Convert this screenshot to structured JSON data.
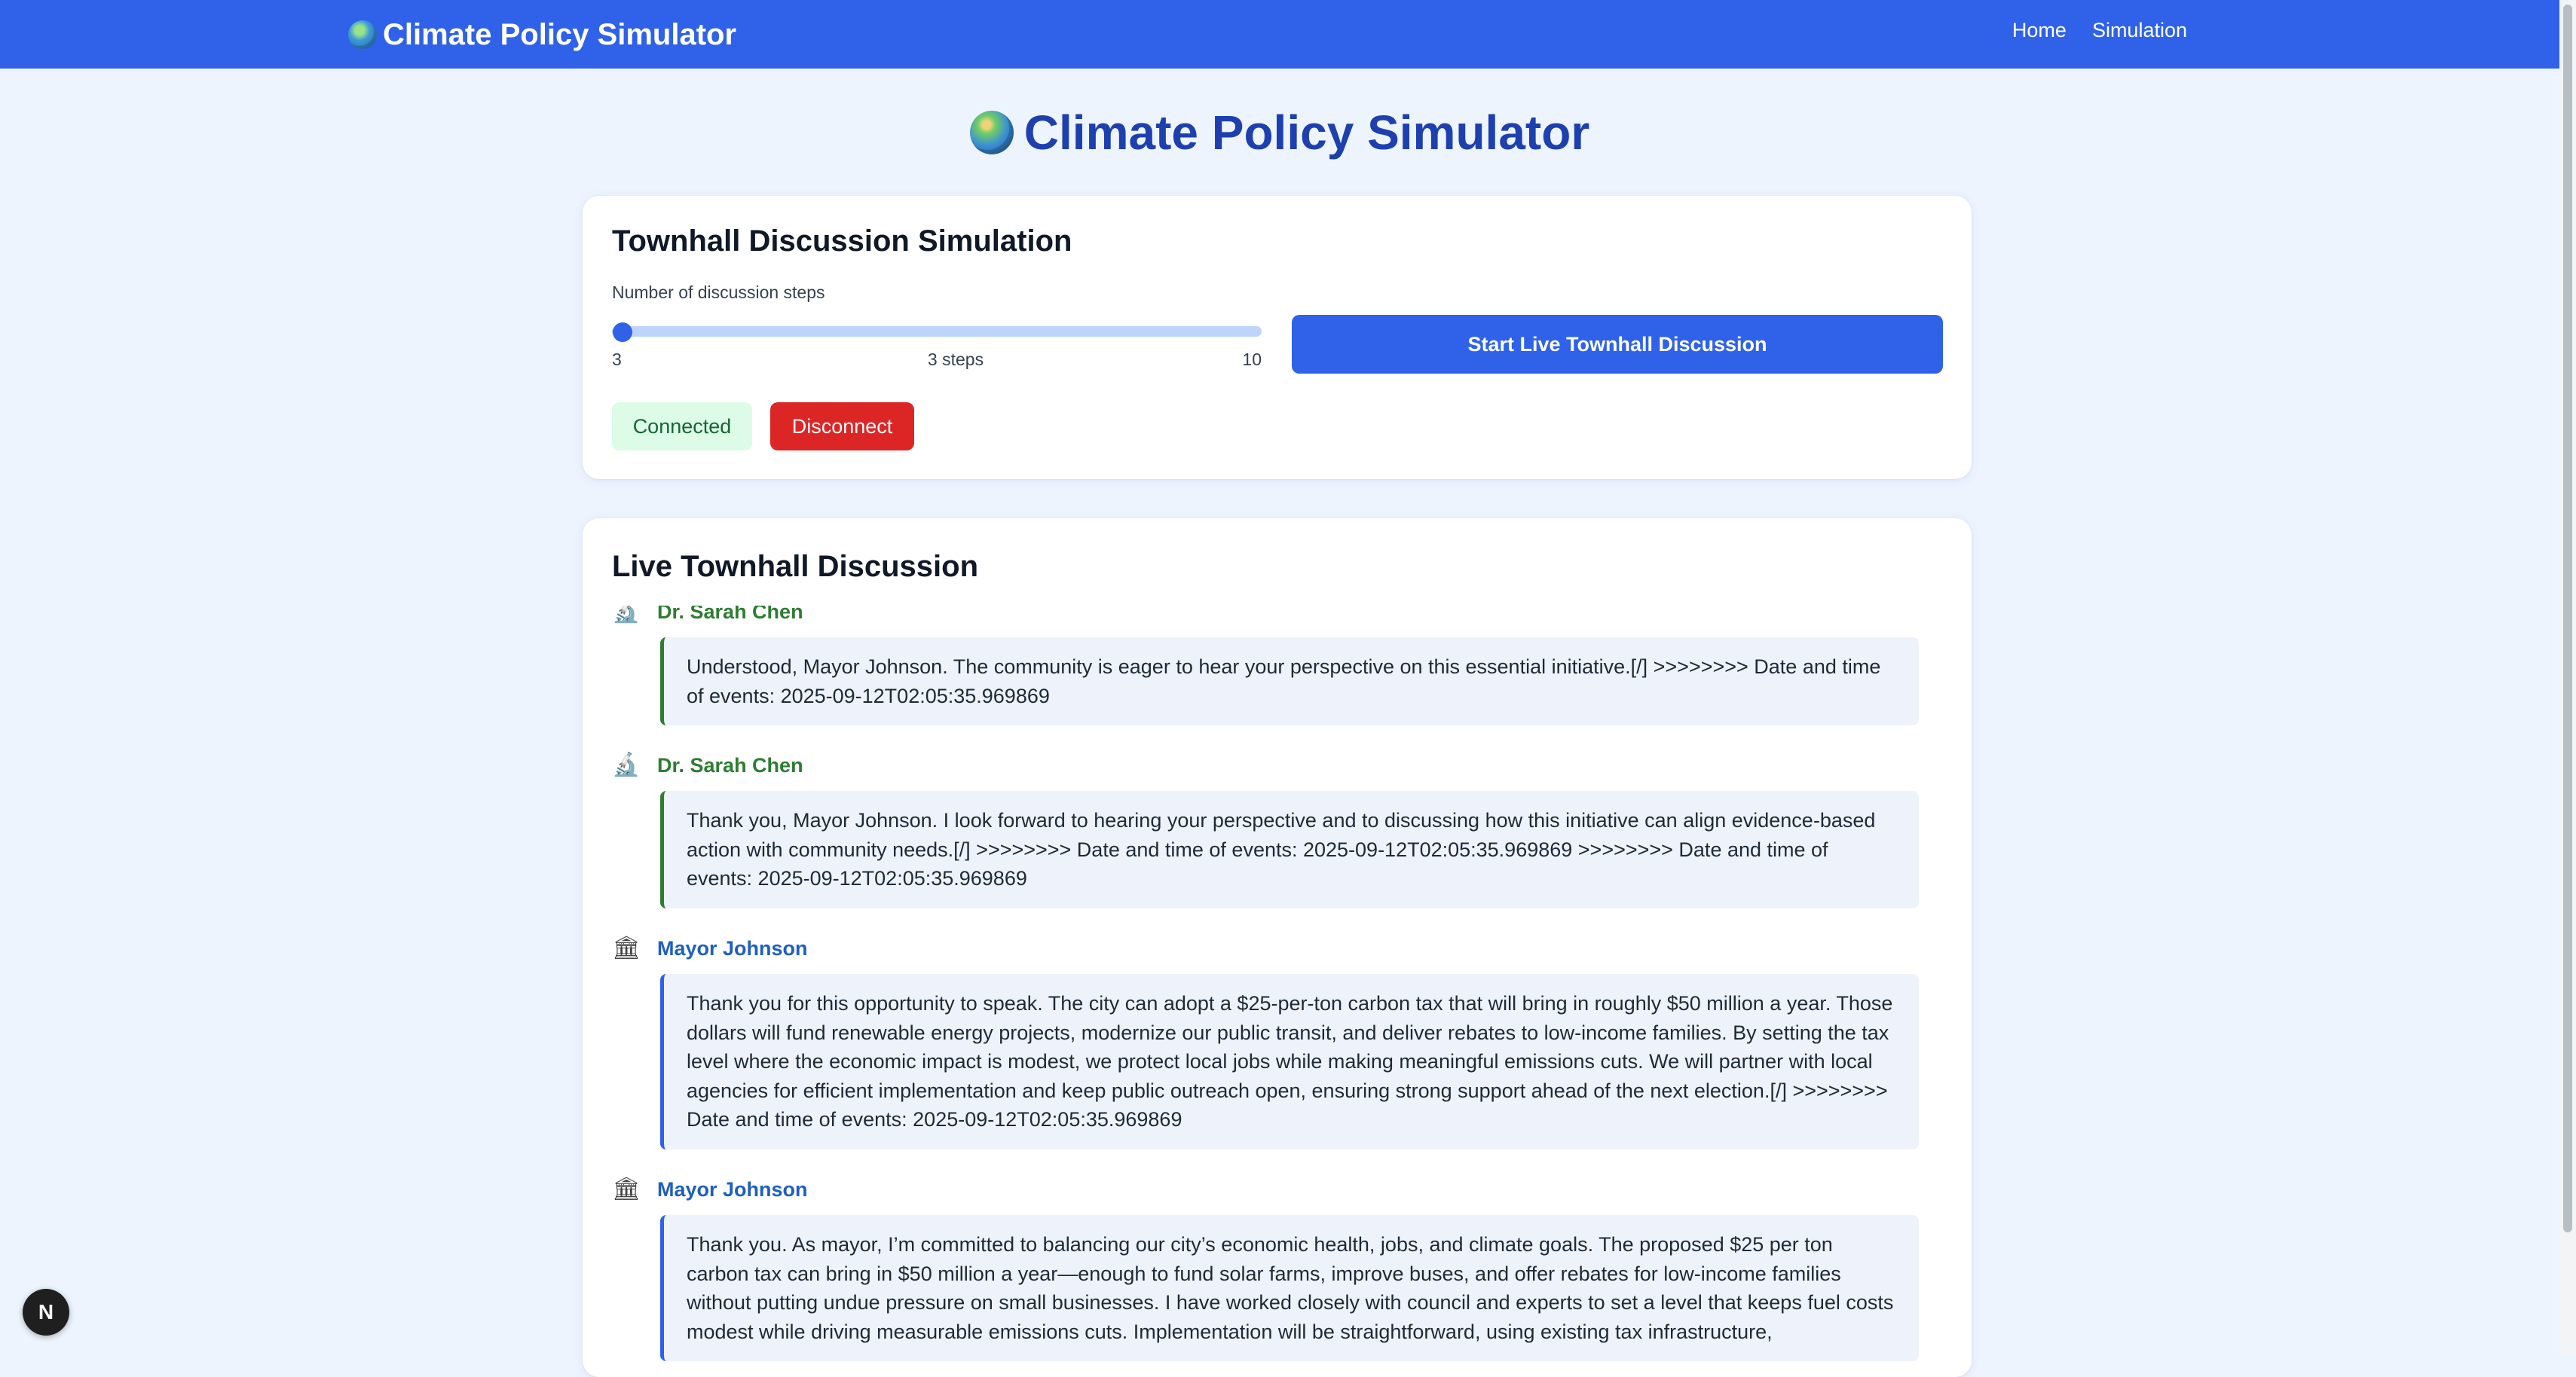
{
  "navbar": {
    "brand": "Climate Policy Simulator",
    "brand_icon": "globe-icon",
    "links": [
      "Home",
      "Simulation"
    ]
  },
  "page": {
    "title": "Climate Policy Simulator",
    "title_icon": "globe-icon"
  },
  "controls": {
    "heading": "Townhall Discussion Simulation",
    "steps_label": "Number of discussion steps",
    "slider": {
      "min": "3",
      "max": "10",
      "value": 3,
      "value_text": "3 steps"
    },
    "start_button": "Start Live Townhall Discussion",
    "status": "Connected",
    "disconnect_button": "Disconnect"
  },
  "discussion": {
    "heading": "Live Townhall Discussion",
    "messages": [
      {
        "speaker": "Dr. Sarah Chen",
        "icon": "microscope-icon",
        "text": "Understood, Mayor Johnson. The community is eager to hear your perspective on this essential initiative.[/] >>>>>>>> Date and time of events: 2025-09-12T02:05:35.969869"
      },
      {
        "speaker": "Dr. Sarah Chen",
        "icon": "microscope-icon",
        "text": "Thank you, Mayor Johnson. I look forward to hearing your perspective and to discussing how this initiative can align evidence-based action with community needs.[/] >>>>>>>> Date and time of events: 2025-09-12T02:05:35.969869 >>>>>>>> Date and time of events: 2025-09-12T02:05:35.969869"
      },
      {
        "speaker": "Mayor Johnson",
        "icon": "classical-building-icon",
        "text": "Thank you for this opportunity to speak. The city can adopt a $25-per-ton carbon tax that will bring in roughly $50 million a year. Those dollars will fund renewable energy projects, modernize our public transit, and deliver rebates to low-income families. By setting the tax level where the economic impact is modest, we protect local jobs while making meaningful emissions cuts. We will partner with local agencies for efficient implementation and keep public outreach open, ensuring strong support ahead of the next election.[/] >>>>>>>> Date and time of events: 2025-09-12T02:05:35.969869"
      },
      {
        "speaker": "Mayor Johnson",
        "icon": "classical-building-icon",
        "text": "Thank you. As mayor, I’m committed to balancing our city’s economic health, jobs, and climate goals. The proposed $25 per ton carbon tax can bring in $50 million a year—enough to fund solar farms, improve buses, and offer rebates for low-income families without putting undue pressure on small businesses. I have worked closely with council and experts to set a level that keeps fuel costs modest while driving measurable emissions cuts. Implementation will be straightforward, using existing tax infrastructure,"
      }
    ]
  },
  "dev_badge": "N",
  "colors": {
    "navbar": "#2f62e8",
    "background": "#eef4fd",
    "title": "#1e40af",
    "scientist": "#2e7d32",
    "mayor": "#1e5fbf",
    "danger": "#dc2626",
    "success_bg": "#dcfce7"
  }
}
